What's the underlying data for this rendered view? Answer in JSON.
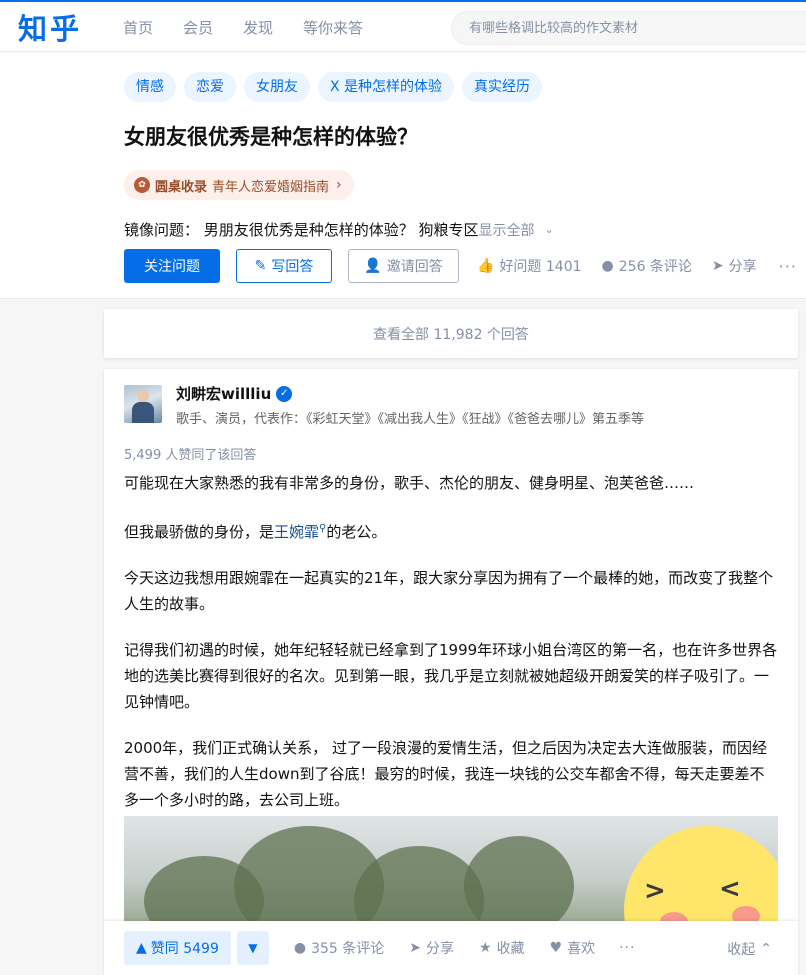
{
  "nav": {
    "logo": "知乎",
    "items": [
      "首页",
      "会员",
      "发现",
      "等你来答"
    ],
    "search_placeholder": "有哪些格调比较高的作文素材"
  },
  "question": {
    "topics": [
      "情感",
      "恋爱",
      "女朋友",
      "X 是种怎样的体验",
      "真实经历"
    ],
    "title": "女朋友很优秀是种怎样的体验？",
    "roundtable_label": "圆桌收录",
    "roundtable_name": "青年人恋爱婚姻指南",
    "mirror_text": "镜像问题：  男朋友很优秀是种怎样的体验？  狗粮专区",
    "show_all": "显示全部",
    "follow_label": "关注问题",
    "write_label": "写回答",
    "invite_label": "邀请回答",
    "good_label": "好问题 1401",
    "comments_label": "256 条评论",
    "share_label": "分享",
    "more_label": "···"
  },
  "view_all": "查看全部 11,982 个回答",
  "answer": {
    "author_name": "刘畊宏willliu",
    "author_bio": "歌手、演员，代表作：《彩虹天堂》《减出我人生》《狂战》《爸爸去哪儿》第五季等",
    "votes_line": "5,499 人赞同了该回答",
    "p1": "可能现在大家熟悉的我有非常多的身份，歌手、杰伦的朋友、健身明星、泡芙爸爸……",
    "p2_before": "但我最骄傲的身份，是",
    "p2_link": "王婉霏",
    "p2_after": "的老公。",
    "p3": "今天这边我想用跟婉霏在一起真实的21年，跟大家分享因为拥有了一个最棒的她，而改变了我整个人生的故事。",
    "p4": "记得我们初遇的时候，她年纪轻轻就已经拿到了1999年环球小姐台湾区的第一名，也在许多世界各地的选美比赛得到很好的名次。见到第一眼，我几乎是立刻就被她超级开朗爱笑的样子吸引了。一见钟情吧。",
    "p5": "2000年，我们正式确认关系， 过了一段浪漫的爱情生活，但之后因为决定去大连做服装，而因经营不善，我们的人生down到了谷底！最穷的时候，我连一块钱的公交车都舍不得，每天走要差不多一个多小时的路，去公司上班。"
  },
  "actionbar": {
    "upvote_label": "赞同 5499",
    "comments_label": "355 条评论",
    "share_label": "分享",
    "collect_label": "收藏",
    "like_label": "喜欢",
    "more_label": "···",
    "collapse_label": "收起"
  },
  "colors": {
    "brand": "#056de8",
    "muted": "#8590a6",
    "roundtable": "#9b4d2b"
  }
}
